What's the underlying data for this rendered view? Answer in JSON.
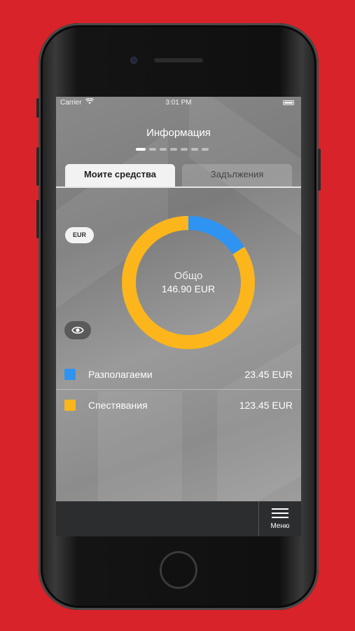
{
  "status_bar": {
    "carrier": "Carrier",
    "time": "3:01 PM"
  },
  "header": {
    "title": "Информация",
    "page_count": 7,
    "active_page": 0
  },
  "tabs": [
    {
      "label": "Моите средства",
      "active": true
    },
    {
      "label": "Задължения",
      "active": false
    }
  ],
  "currency_toggle": "EUR",
  "chart_data": {
    "type": "pie",
    "center_label": "Общо",
    "center_value": "146.90 EUR",
    "slices": [
      {
        "name": "Разполагаеми",
        "value": 23.45,
        "color": "#2f93f2"
      },
      {
        "name": "Спестявания",
        "value": 123.45,
        "color": "#fcb61b"
      }
    ]
  },
  "legend": [
    {
      "label": "Разполагаеми",
      "value": "23.45 EUR",
      "color": "#2f93f2"
    },
    {
      "label": "Спестявания",
      "value": "123.45 EUR",
      "color": "#fcb61b"
    }
  ],
  "bottom_bar": {
    "menu_label": "Меню"
  },
  "colors": {
    "background": "#d8232a",
    "accent_blue": "#2f93f2",
    "accent_yellow": "#fcb61b",
    "bar": "#2c2d2f"
  }
}
